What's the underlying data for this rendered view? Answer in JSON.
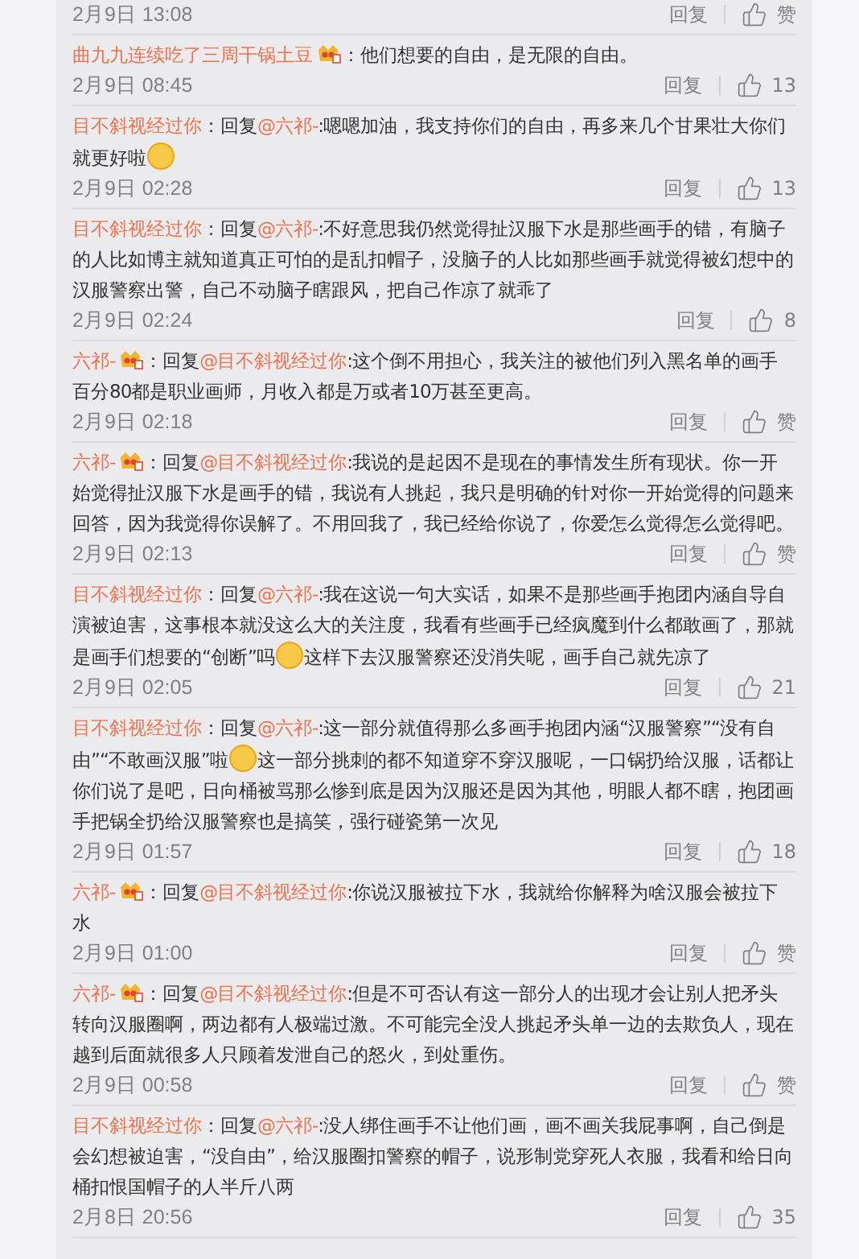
{
  "comments": [
    {
      "date": "2月9日 13:08",
      "reply": "回复",
      "likes": "赞"
    },
    {
      "body": [
        {
          "kind": "author",
          "text": "曲九九连续吃了三周干锅土豆"
        },
        {
          "kind": "badge"
        },
        {
          "kind": "text",
          "text": "：他们想要的自由，是无限的自由。"
        }
      ],
      "date": "2月9日 08:45",
      "reply": "回复",
      "likes": "13"
    },
    {
      "body": [
        {
          "kind": "author",
          "text": "目不斜视经过你"
        },
        {
          "kind": "text",
          "text": "：回复"
        },
        {
          "kind": "mention",
          "text": "@六祁-"
        },
        {
          "kind": "text",
          "text": ":嗯嗯加油，我支持你们的自由，再多来几个甘果壮大你们就更好啦"
        },
        {
          "kind": "emoji"
        }
      ],
      "date": "2月9日 02:28",
      "reply": "回复",
      "likes": "13"
    },
    {
      "body": [
        {
          "kind": "author",
          "text": "目不斜视经过你"
        },
        {
          "kind": "text",
          "text": "：回复"
        },
        {
          "kind": "mention",
          "text": "@六祁-"
        },
        {
          "kind": "text",
          "text": ":不好意思我仍然觉得扯汉服下水是那些画手的错，有脑子的人比如博主就知道真正可怕的是乱扣帽子，没脑子的人比如那些画手就觉得被幻想中的汉服警察出警，自己不动脑子瞎跟风，把自己作凉了就乖了"
        }
      ],
      "date": "2月9日 02:24",
      "reply": "回复",
      "likes": "8"
    },
    {
      "body": [
        {
          "kind": "author",
          "text": "六祁-"
        },
        {
          "kind": "badge"
        },
        {
          "kind": "text",
          "text": "：回复"
        },
        {
          "kind": "mention",
          "text": "@目不斜视经过你"
        },
        {
          "kind": "text",
          "text": ":这个倒不用担心，我关注的被他们列入黑名单的画手百分80都是职业画师，月收入都是万或者10万甚至更高。"
        }
      ],
      "date": "2月9日 02:18",
      "reply": "回复",
      "likes": "赞"
    },
    {
      "body": [
        {
          "kind": "author",
          "text": "六祁-"
        },
        {
          "kind": "badge"
        },
        {
          "kind": "text",
          "text": "：回复"
        },
        {
          "kind": "mention",
          "text": "@目不斜视经过你"
        },
        {
          "kind": "text",
          "text": ":我说的是起因不是现在的事情发生所有现状。你一开始觉得扯汉服下水是画手的错，我说有人挑起，我只是明确的针对你一开始觉得的问题来回答，因为我觉得你误解了。不用回我了，我已经给你说了，你爱怎么觉得怎么觉得吧。"
        }
      ],
      "date": "2月9日 02:13",
      "reply": "回复",
      "likes": "赞"
    },
    {
      "body": [
        {
          "kind": "author",
          "text": "目不斜视经过你"
        },
        {
          "kind": "text",
          "text": "：回复"
        },
        {
          "kind": "mention",
          "text": "@六祁-"
        },
        {
          "kind": "text",
          "text": ":我在这说一句大实话，如果不是那些画手抱团内涵自导自演被迫害，这事根本就没这么大的关注度，我看有些画手已经疯魔到什么都敢画了，那就是画手们想要的“创断”吗"
        },
        {
          "kind": "emoji"
        },
        {
          "kind": "text",
          "text": "这样下去汉服警察还没消失呢，画手自己就先凉了"
        }
      ],
      "date": "2月9日 02:05",
      "reply": "回复",
      "likes": "21"
    },
    {
      "body": [
        {
          "kind": "author",
          "text": "目不斜视经过你"
        },
        {
          "kind": "text",
          "text": "：回复"
        },
        {
          "kind": "mention",
          "text": "@六祁-"
        },
        {
          "kind": "text",
          "text": ":这一部分就值得那么多画手抱团内涵“汉服警察”“没有自由”“不敢画汉服”啦"
        },
        {
          "kind": "emoji"
        },
        {
          "kind": "text",
          "text": "这一部分挑刺的都不知道穿不穿汉服呢，一口锅扔给汉服，话都让你们说了是吧，日向桶被骂那么惨到底是因为汉服还是因为其他，明眼人都不瞎，抱团画手把锅全扔给汉服警察也是搞笑，强行碰瓷第一次见"
        }
      ],
      "date": "2月9日 01:57",
      "reply": "回复",
      "likes": "18"
    },
    {
      "body": [
        {
          "kind": "author",
          "text": "六祁-"
        },
        {
          "kind": "badge"
        },
        {
          "kind": "text",
          "text": "：回复"
        },
        {
          "kind": "mention",
          "text": "@目不斜视经过你"
        },
        {
          "kind": "text",
          "text": ":你说汉服被拉下水，我就给你解释为啥汉服会被拉下水"
        }
      ],
      "date": "2月9日 01:00",
      "reply": "回复",
      "likes": "赞"
    },
    {
      "body": [
        {
          "kind": "author",
          "text": "六祁-"
        },
        {
          "kind": "badge"
        },
        {
          "kind": "text",
          "text": "：回复"
        },
        {
          "kind": "mention",
          "text": "@目不斜视经过你"
        },
        {
          "kind": "text",
          "text": ":但是不可否认有这一部分人的出现才会让别人把矛头转向汉服圈啊，两边都有人极端过激。不可能完全没人挑起矛头单一边的去欺负人，现在越到后面就很多人只顾着发泄自己的怒火，到处重伤。"
        }
      ],
      "date": "2月9日 00:58",
      "reply": "回复",
      "likes": "赞"
    },
    {
      "body": [
        {
          "kind": "author",
          "text": "目不斜视经过你"
        },
        {
          "kind": "text",
          "text": "：回复"
        },
        {
          "kind": "mention",
          "text": "@六祁-"
        },
        {
          "kind": "text",
          "text": ":没人绑住画手不让他们画，画不画关我屁事啊，自己倒是会幻想被迫害，“没自由”，给汉服圈扣警察的帽子，说形制党穿死人衣服，我看和给日向桶扣恨国帽子的人半斤八两"
        }
      ],
      "date": "2月8日 20:56",
      "reply": "回复",
      "likes": "35"
    }
  ]
}
